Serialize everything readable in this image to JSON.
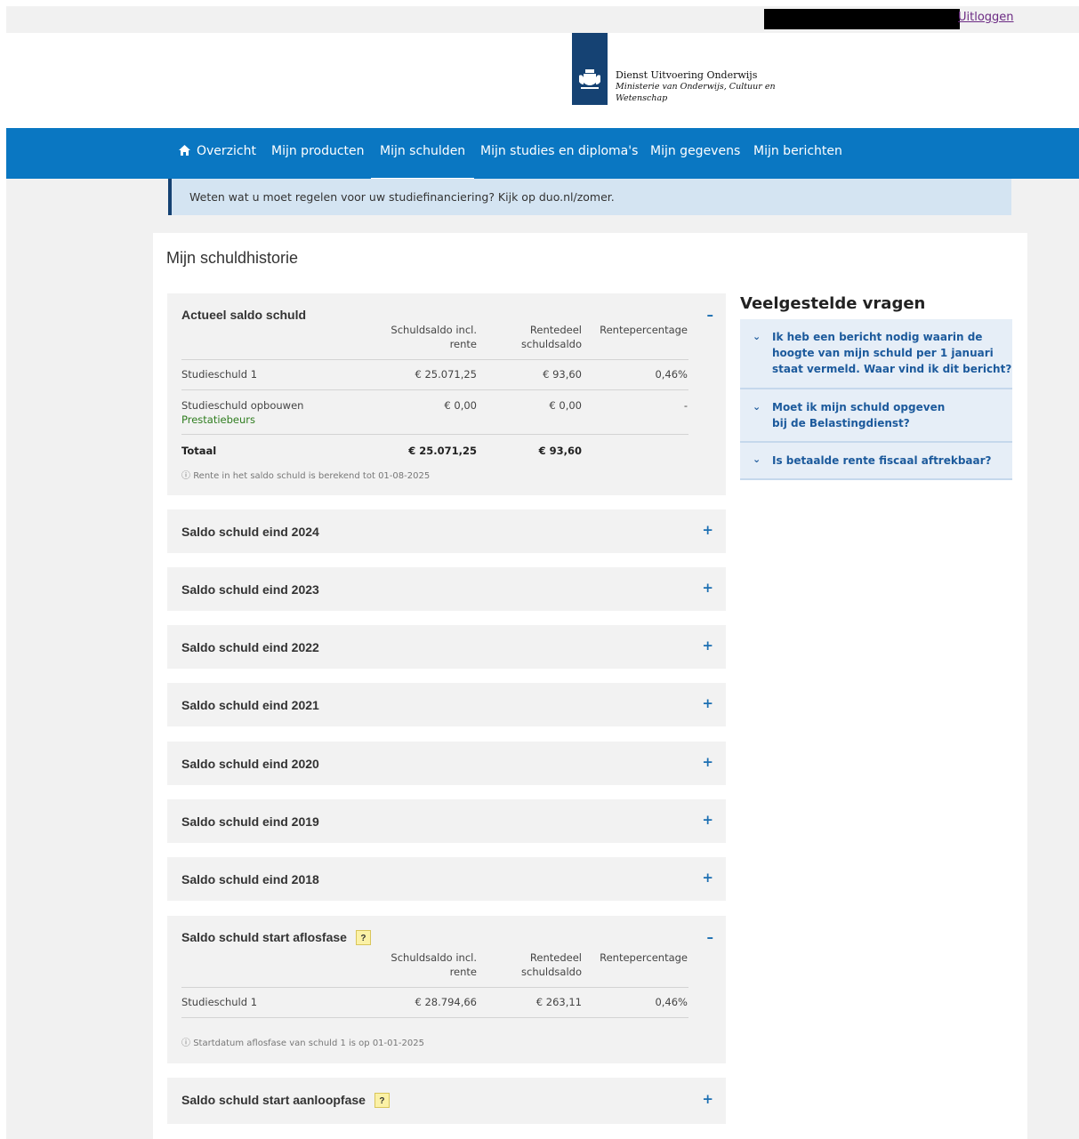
{
  "header": {
    "logout": "Uitloggen"
  },
  "logo": {
    "line1": "Dienst Uitvoering Onderwijs",
    "line2": "Ministerie van Onderwijs, Cultuur en",
    "line3": "Wetenschap",
    "brand_color": "#154273"
  },
  "nav": {
    "items": [
      "Overzicht",
      "Mijn producten",
      "Mijn schulden",
      "Mijn studies en diploma's",
      "Mijn gegevens",
      "Mijn berichten"
    ],
    "active_index": 2,
    "color": "#0a77c2"
  },
  "notice": {
    "text": "Weten wat u moet regelen voor uw studiefinanciering? Kijk op duo.nl/zomer."
  },
  "page_title": "Mijn schuldhistorie",
  "columns": {
    "saldo_l1": "Schuldsaldo incl.",
    "saldo_l2": "rente",
    "rentedeel_l1": "Rentedeel",
    "rentedeel_l2": "schuldsaldo",
    "percentage": "Rentepercentage"
  },
  "actueel": {
    "title": "Actueel saldo schuld",
    "toggle": "–",
    "rows": [
      {
        "label": "Studieschuld 1",
        "sublabel": "",
        "saldo": "€ 25.071,25",
        "rentedeel": "€ 93,60",
        "pct": "0,46%"
      },
      {
        "label": "Studieschuld opbouwen",
        "sublabel": "Prestatiebeurs",
        "saldo": "€ 0,00",
        "rentedeel": "€ 0,00",
        "pct": "-"
      }
    ],
    "total": {
      "label": "Totaal",
      "saldo": "€ 25.071,25",
      "rentedeel": "€ 93,60"
    },
    "note": "Rente in het saldo schuld is berekend tot 01-08-2025"
  },
  "collapsed": [
    {
      "title": "Saldo schuld eind 2024",
      "toggle": "+"
    },
    {
      "title": "Saldo schuld eind 2023",
      "toggle": "+"
    },
    {
      "title": "Saldo schuld eind 2022",
      "toggle": "+"
    },
    {
      "title": "Saldo schuld eind 2021",
      "toggle": "+"
    },
    {
      "title": "Saldo schuld eind 2020",
      "toggle": "+"
    },
    {
      "title": "Saldo schuld eind 2019",
      "toggle": "+"
    },
    {
      "title": "Saldo schuld eind 2018",
      "toggle": "+"
    }
  ],
  "aflosfase": {
    "title": "Saldo schuld start aflosfase",
    "help": "?",
    "toggle": "–",
    "rows": [
      {
        "label": "Studieschuld 1",
        "saldo": "€ 28.794,66",
        "rentedeel": "€ 263,11",
        "pct": "0,46%"
      }
    ],
    "note": "Startdatum aflosfase van schuld 1 is op 01-01-2025"
  },
  "aanloopfase": {
    "title": "Saldo schuld start aanloopfase",
    "help": "?",
    "toggle": "+"
  },
  "faq": {
    "title": "Veelgestelde vragen",
    "items": [
      {
        "l1": "Ik heb een bericht nodig waarin de",
        "l2": "hoogte van mijn schuld per 1 januari",
        "l3": "staat vermeld. Waar vind ik dit bericht?"
      },
      {
        "l1": "Moet ik mijn schuld opgeven",
        "l2": "bij de Belastingdienst?",
        "l3": ""
      },
      {
        "l1": "Is betaalde rente fiscaal aftrekbaar?",
        "l2": "",
        "l3": ""
      }
    ]
  }
}
